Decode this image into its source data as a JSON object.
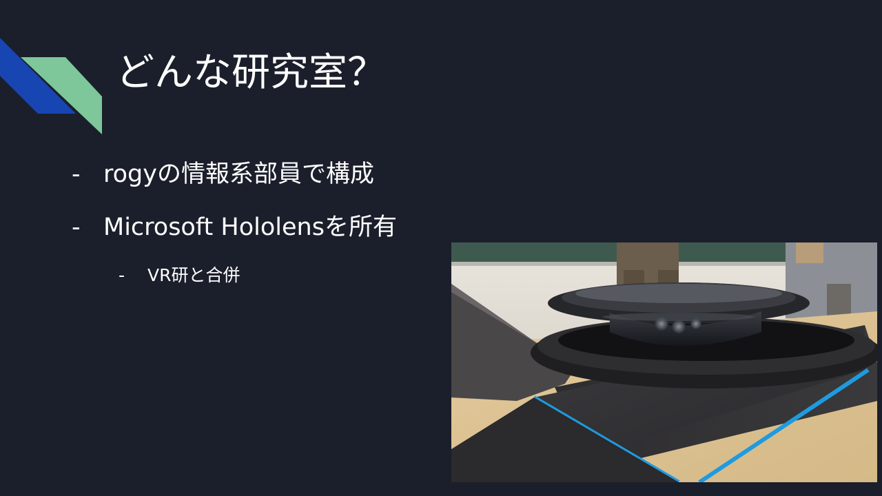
{
  "slide": {
    "title": "どんな研究室？",
    "bullets": [
      {
        "marker": "-",
        "text": "rogyの情報系部員で構成"
      },
      {
        "marker": "-",
        "text": "Microsoft Hololensを所有"
      }
    ],
    "sub_bullets": [
      {
        "marker": "-",
        "text": "VR研と合併"
      }
    ],
    "photo": {
      "subject": "hololens-headset-in-box"
    }
  },
  "colors": {
    "background": "#1b1f2b",
    "accent_blue": "#1746b3",
    "accent_green": "#7dc79a",
    "text": "#ffffff",
    "box_blue_trim": "#1e9be0"
  }
}
